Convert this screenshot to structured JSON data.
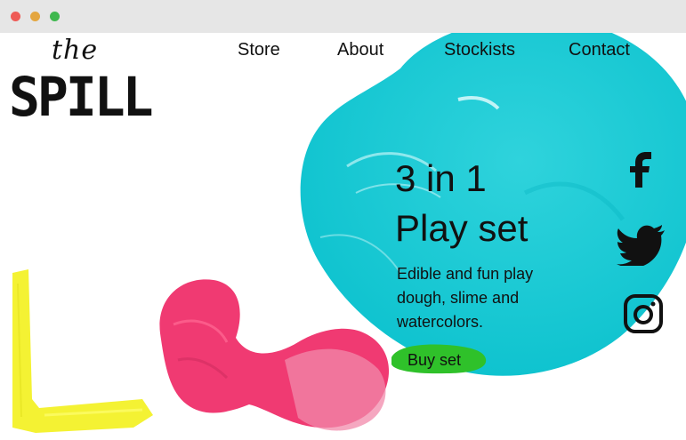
{
  "window": {
    "controls": [
      "close",
      "minimize",
      "maximize"
    ],
    "control_colors": {
      "close": "#ee5b56",
      "minimize": "#e4a640",
      "maximize": "#40b84f"
    }
  },
  "logo": {
    "small": "the",
    "big": "SPILL"
  },
  "nav": {
    "items": [
      {
        "label": "Store"
      },
      {
        "label": "About"
      },
      {
        "label": "Stockists"
      },
      {
        "label": "Contact"
      }
    ]
  },
  "hero": {
    "headline_line1": "3 in 1",
    "headline_line2": "Play set",
    "description": "Edible and fun play dough, slime and watercolors.",
    "button_label": "Buy set"
  },
  "social": {
    "icons": [
      "facebook-icon",
      "twitter-icon",
      "instagram-icon"
    ]
  },
  "colors": {
    "cyan_paint": "#12c9d4",
    "pink_paint": "#f03a72",
    "yellow_paint": "#f4f233",
    "green_paint": "#2fc12a",
    "text": "#111111"
  }
}
